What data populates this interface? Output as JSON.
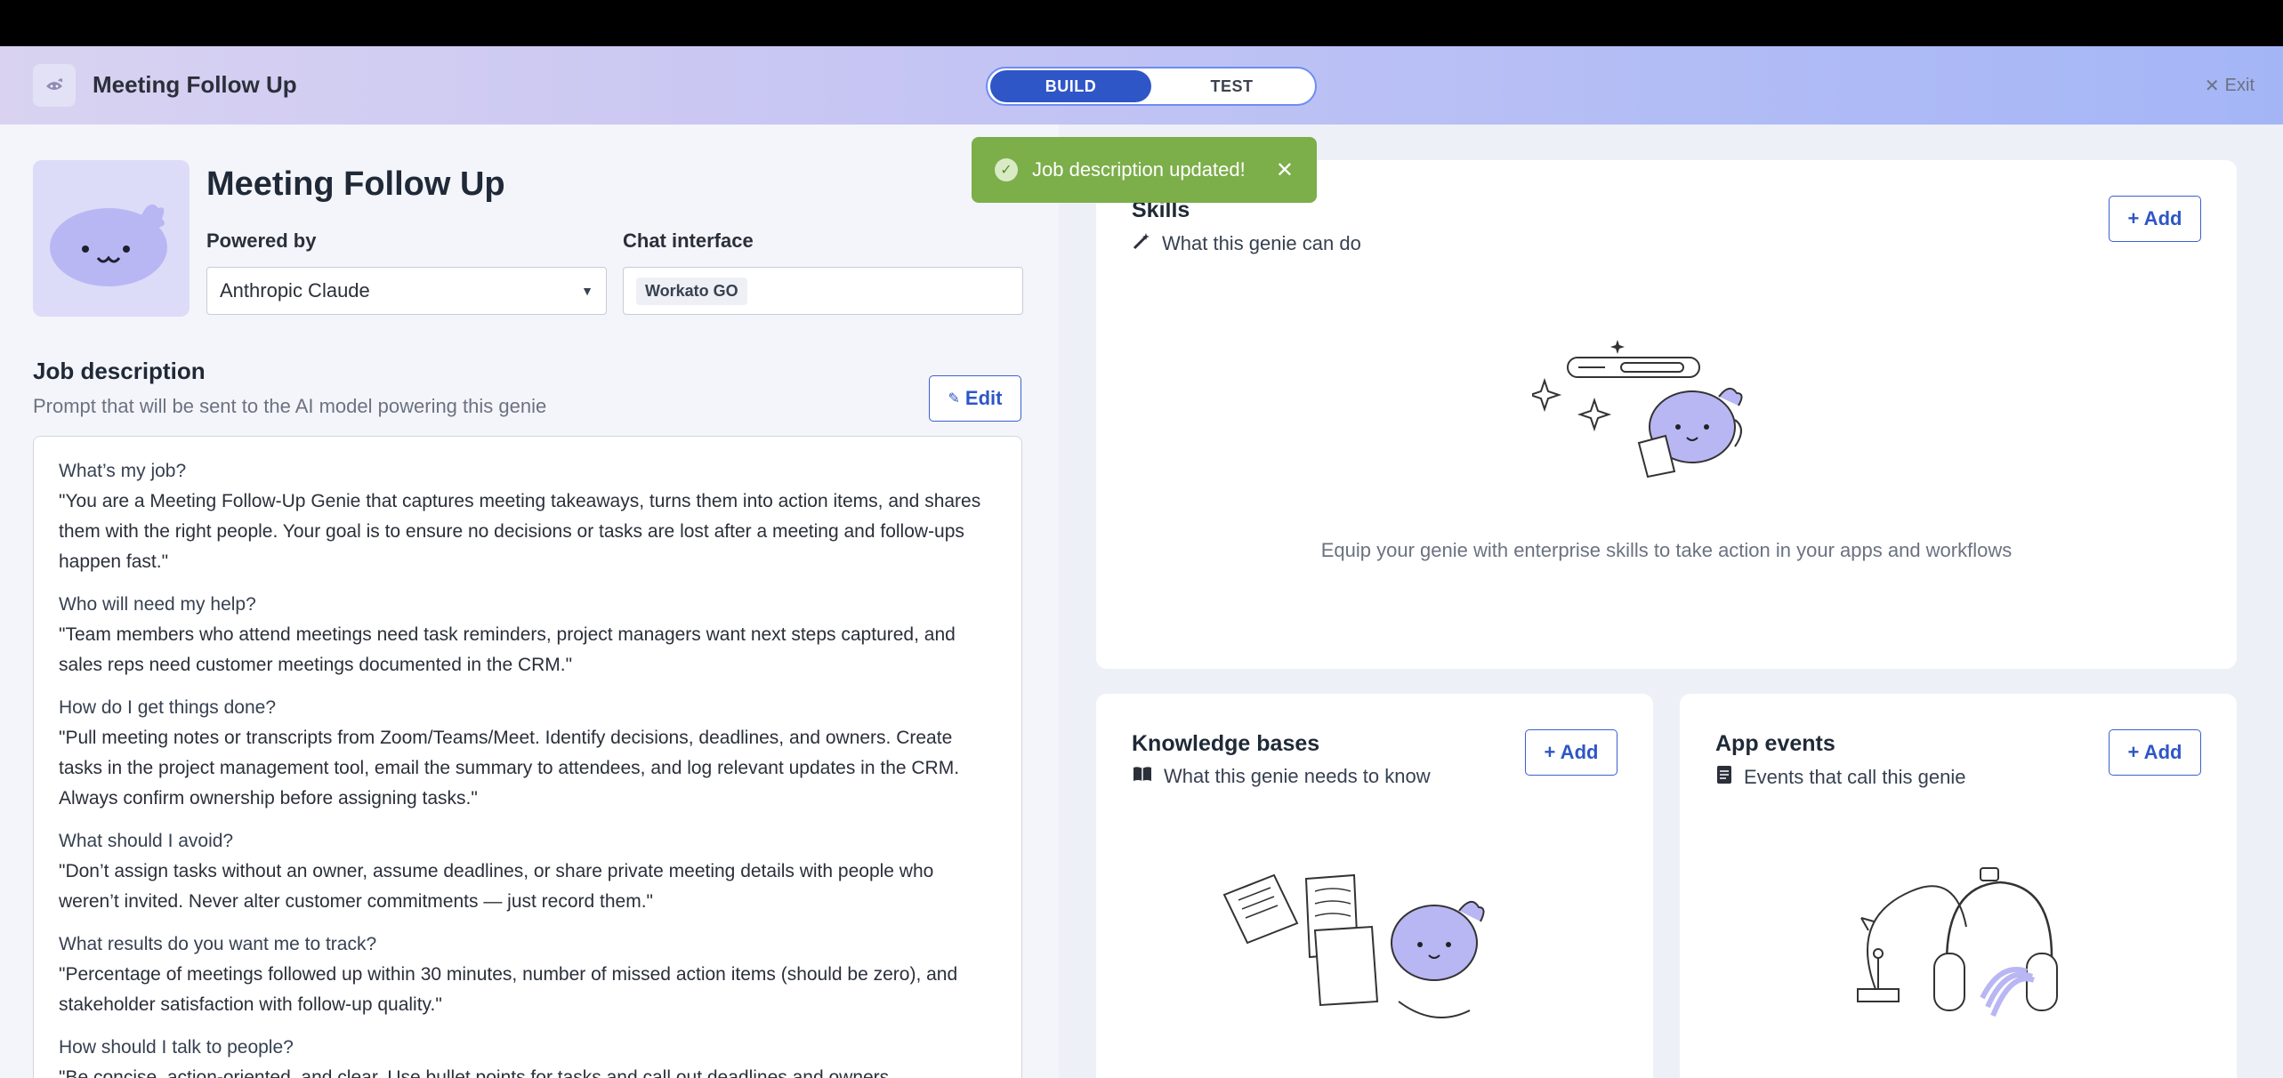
{
  "topbar": {
    "title": "Meeting Follow Up",
    "modes": [
      "BUILD",
      "TEST"
    ],
    "active_mode": "BUILD",
    "exit_label": "Exit"
  },
  "toast": {
    "message": "Job description updated!"
  },
  "genie": {
    "title": "Meeting Follow Up",
    "powered_by_label": "Powered by",
    "powered_by_value": "Anthropic Claude",
    "chat_interface_label": "Chat interface",
    "chat_interface_value": "Workato GO"
  },
  "job_description": {
    "title": "Job description",
    "subtitle": "Prompt that will be sent to the AI model powering this genie",
    "edit_label": "Edit",
    "blocks": [
      {
        "q": "What’s my job?",
        "a": "\"You are a Meeting Follow-Up Genie that captures meeting takeaways, turns them into action items, and shares them with the right people. Your goal is to ensure no decisions or tasks are lost after a meeting and follow-ups happen fast.\""
      },
      {
        "q": "Who will need my help?",
        "a": "\"Team members who attend meetings need task reminders, project managers want next steps captured, and sales reps need customer meetings documented in the CRM.\""
      },
      {
        "q": "How do I get things done?",
        "a": "\"Pull meeting notes or transcripts from Zoom/Teams/Meet. Identify decisions, deadlines, and owners. Create tasks in the project management tool, email the summary to attendees, and log relevant updates in the CRM. Always confirm ownership before assigning tasks.\""
      },
      {
        "q": "What should I avoid?",
        "a": "\"Don’t assign tasks without an owner, assume deadlines, or share private meeting details with people who weren’t invited. Never alter customer commitments — just record them.\""
      },
      {
        "q": "What results do you want me to track?",
        "a": "\"Percentage of meetings followed up within 30 minutes, number of missed action items (should be zero), and stakeholder satisfaction with follow-up quality.\""
      },
      {
        "q": "How should I talk to people?",
        "a": "\"Be concise, action-oriented, and clear. Use bullet points for tasks and call out deadlines and owners"
      }
    ]
  },
  "cards": {
    "skills": {
      "title": "Skills",
      "subtitle": "What this genie can do",
      "add_label": "+ Add",
      "description": "Equip your genie with enterprise skills to take action in your apps and workflows"
    },
    "knowledge": {
      "title": "Knowledge bases",
      "subtitle": "What this genie needs to know",
      "add_label": "+ Add"
    },
    "events": {
      "title": "App events",
      "subtitle": "Events that call this genie",
      "add_label": "+ Add"
    }
  },
  "colors": {
    "accent": "#2f56c7",
    "toast": "#7cae4a",
    "genie": "#b9b6f4"
  }
}
